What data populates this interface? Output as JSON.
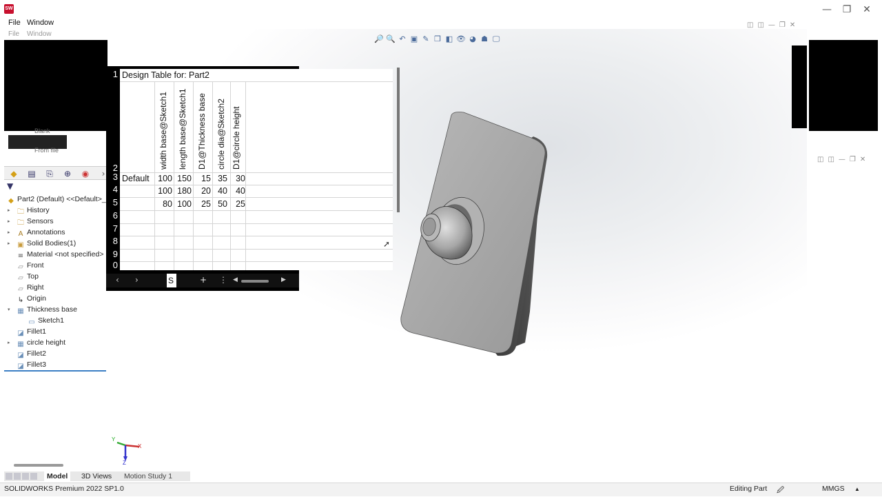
{
  "menu": {
    "file": "File",
    "window": "Window",
    "ghost_file": "File",
    "ghost_window": "Window"
  },
  "window_controls": {
    "minimize": "—",
    "restore": "❐",
    "close": "✕"
  },
  "feature_manager": {
    "radio_blank": "Blank",
    "radio_from_file": "From file",
    "root": "Part2 (Default) <<Default>_P",
    "items": [
      {
        "label": "History",
        "icon": "history-folder-icon"
      },
      {
        "label": "Sensors",
        "icon": "sensors-folder-icon"
      },
      {
        "label": "Annotations",
        "icon": "annotations-icon"
      },
      {
        "label": "Solid Bodies(1)",
        "icon": "solid-bodies-icon"
      },
      {
        "label": "Material <not specified>",
        "icon": "material-icon"
      },
      {
        "label": "Front",
        "icon": "plane-icon"
      },
      {
        "label": "Top",
        "icon": "plane-icon"
      },
      {
        "label": "Right",
        "icon": "plane-icon"
      },
      {
        "label": "Origin",
        "icon": "origin-icon"
      },
      {
        "label": "Thickness base",
        "icon": "extrude-icon"
      },
      {
        "label": "Sketch1",
        "icon": "sketch-icon"
      },
      {
        "label": "Fillet1",
        "icon": "fillet-icon"
      },
      {
        "label": "circle height",
        "icon": "extrude-icon"
      },
      {
        "label": "Fillet2",
        "icon": "fillet-icon"
      },
      {
        "label": "Fillet3",
        "icon": "fillet-icon"
      }
    ]
  },
  "design_table": {
    "title": "Design Table for: Part2",
    "row_numbers": [
      "1",
      "2",
      "3",
      "4",
      "5",
      "6",
      "7",
      "8",
      "9",
      "0"
    ],
    "columns": [
      "width base@Sketch1",
      "length base@Sketch1",
      "D1@Thickness base",
      "circle dia@Sketch2",
      "D1@circle height"
    ],
    "rows": [
      {
        "name": "Default",
        "values": [
          "100",
          "150",
          "15",
          "35",
          "30"
        ]
      },
      {
        "name": "",
        "values": [
          "100",
          "180",
          "20",
          "40",
          "40"
        ]
      },
      {
        "name": "",
        "values": [
          "80",
          "100",
          "25",
          "50",
          "25"
        ]
      }
    ],
    "sheet_tab": "S",
    "nav_prev": "‹",
    "nav_next": "›",
    "add_sheet": "+",
    "sheet_menu": "⋮"
  },
  "bottom_tabs": {
    "model": "Model",
    "views3d": "3D Views",
    "motion": "Motion Study 1"
  },
  "status": {
    "app": "SOLIDWORKS Premium 2022 SP1.0",
    "mode": "Editing Part",
    "units": "MMGS",
    "units_arrow": "▲"
  },
  "triad": {
    "x": "X",
    "y": "Y",
    "z": "Z"
  },
  "colors": {
    "accent": "#3b7fc4",
    "part_face": "#a8a8a8",
    "part_edge": "#3a3a3a"
  }
}
